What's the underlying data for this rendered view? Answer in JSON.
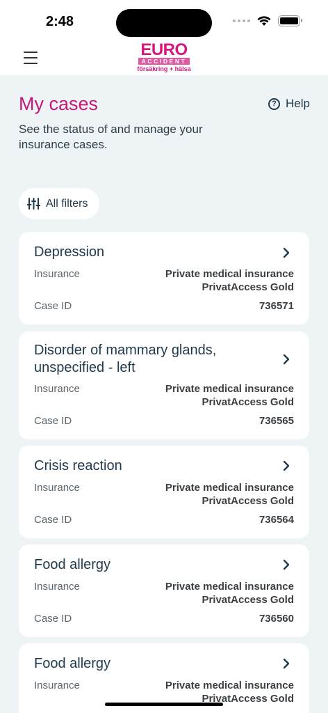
{
  "status_bar": {
    "time": "2:48"
  },
  "logo": {
    "brand": "EURO",
    "band": "ACCIDENT",
    "tagline": "försäkring + hälsa"
  },
  "page": {
    "title": "My cases",
    "help_label": "Help",
    "subtitle": "See the status of and manage your insurance cases."
  },
  "filters": {
    "label": "All filters"
  },
  "cases": [
    {
      "title": "Depression",
      "insurance_label": "Insurance",
      "insurance_line1": "Private medical insurance",
      "insurance_line2": "PrivatAccess Gold",
      "case_id_label": "Case ID",
      "case_id": "736571"
    },
    {
      "title": "Disorder of mammary glands, unspecified - left",
      "insurance_label": "Insurance",
      "insurance_line1": "Private medical insurance",
      "insurance_line2": "PrivatAccess Gold",
      "case_id_label": "Case ID",
      "case_id": "736565"
    },
    {
      "title": "Crisis reaction",
      "insurance_label": "Insurance",
      "insurance_line1": "Private medical insurance",
      "insurance_line2": "PrivatAccess Gold",
      "case_id_label": "Case ID",
      "case_id": "736564"
    },
    {
      "title": "Food allergy",
      "insurance_label": "Insurance",
      "insurance_line1": "Private medical insurance",
      "insurance_line2": "PrivatAccess Gold",
      "case_id_label": "Case ID",
      "case_id": "736560"
    },
    {
      "title": "Food allergy",
      "insurance_label": "Insurance",
      "insurance_line1": "Private medical insurance",
      "insurance_line2": "PrivatAccess Gold"
    }
  ],
  "colors": {
    "brand": "#c4187d",
    "background": "#eef4f6",
    "text": "#1f3a4d"
  },
  "icons": {
    "menu": "hamburger-icon",
    "help": "question-circle-icon",
    "filter": "sliders-icon",
    "chevron": "chevron-right-icon"
  }
}
